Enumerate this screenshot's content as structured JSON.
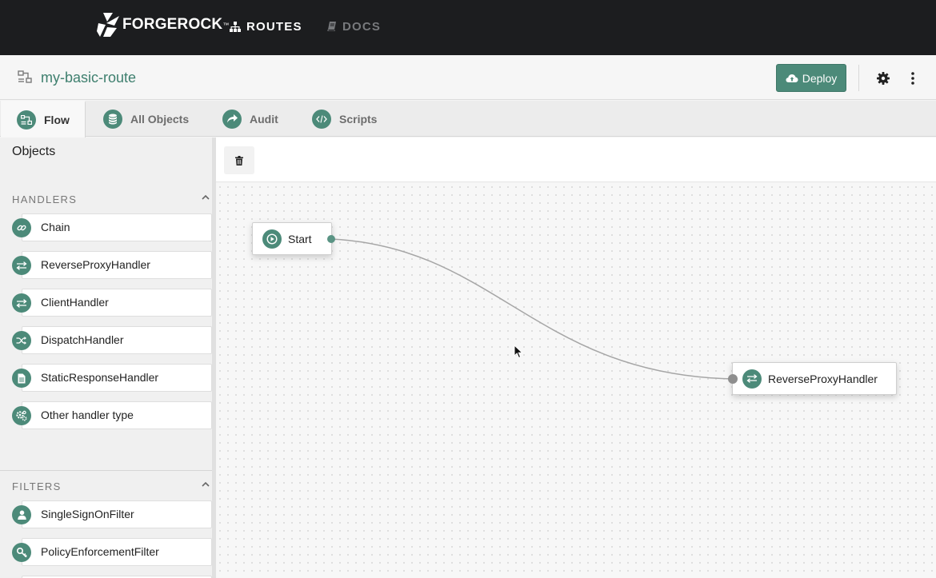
{
  "topbar": {
    "brand": "FORGEROCK",
    "brand_mark": "™",
    "nav": [
      {
        "label": "ROUTES",
        "icon": "sitemap-icon",
        "active": true
      },
      {
        "label": "DOCS",
        "icon": "book-icon",
        "active": false
      }
    ]
  },
  "route": {
    "name": "my-basic-route",
    "deploy_label": "Deploy"
  },
  "tabs": [
    {
      "label": "Flow",
      "icon": "flow-icon",
      "active": true
    },
    {
      "label": "All Objects",
      "icon": "database-icon",
      "active": false
    },
    {
      "label": "Audit",
      "icon": "share-icon",
      "active": false
    },
    {
      "label": "Scripts",
      "icon": "code-icon",
      "active": false
    }
  ],
  "sidebar": {
    "title": "Objects",
    "handlers": {
      "label": "HANDLERS",
      "items": [
        {
          "label": "Chain",
          "icon": "link-icon"
        },
        {
          "label": "ReverseProxyHandler",
          "icon": "exchange-icon"
        },
        {
          "label": "ClientHandler",
          "icon": "exchange-icon"
        },
        {
          "label": "DispatchHandler",
          "icon": "shuffle-icon"
        },
        {
          "label": "StaticResponseHandler",
          "icon": "document-icon"
        },
        {
          "label": "Other handler type",
          "icon": "cogs-icon"
        }
      ]
    },
    "filters": {
      "label": "FILTERS",
      "items": [
        {
          "label": "SingleSignOnFilter",
          "icon": "user-icon"
        },
        {
          "label": "PolicyEnforcementFilter",
          "icon": "key-icon"
        }
      ]
    }
  },
  "canvas": {
    "nodes": [
      {
        "label": "Start",
        "icon": "play-icon"
      },
      {
        "label": "ReverseProxyHandler",
        "icon": "exchange-icon"
      }
    ]
  },
  "colors": {
    "accent": "#4c8a79",
    "topbar": "#1c1d1f",
    "route_name": "#3e7f6e"
  }
}
